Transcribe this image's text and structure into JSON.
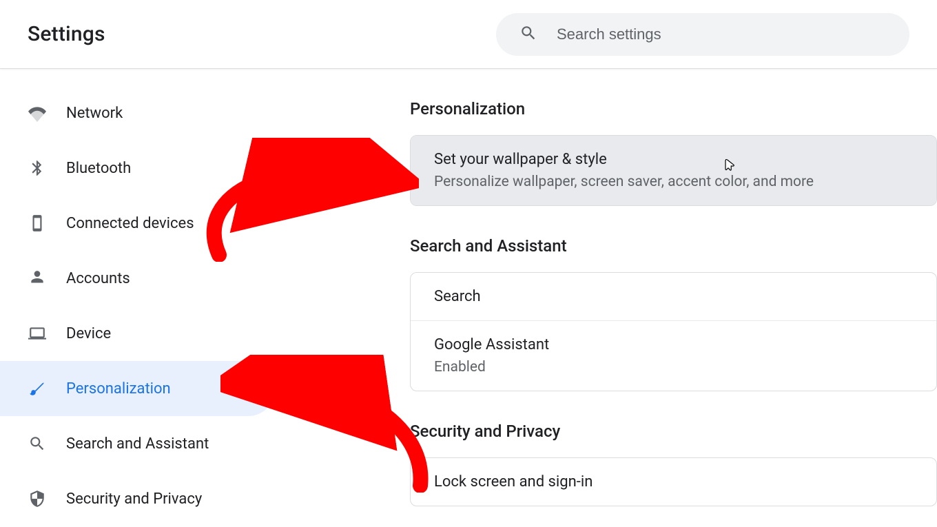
{
  "colors": {
    "accent": "#1a73e8",
    "arrow": "#ff0000"
  },
  "header": {
    "title": "Settings",
    "search_placeholder": "Search settings"
  },
  "sidebar": {
    "items": [
      {
        "id": "network",
        "label": "Network",
        "icon": "wifi-icon"
      },
      {
        "id": "bluetooth",
        "label": "Bluetooth",
        "icon": "bluetooth-icon"
      },
      {
        "id": "devices",
        "label": "Connected devices",
        "icon": "phone-icon"
      },
      {
        "id": "accounts",
        "label": "Accounts",
        "icon": "person-icon"
      },
      {
        "id": "device",
        "label": "Device",
        "icon": "laptop-icon"
      },
      {
        "id": "personalization",
        "label": "Personalization",
        "icon": "brush-icon"
      },
      {
        "id": "search",
        "label": "Search and Assistant",
        "icon": "search-icon"
      },
      {
        "id": "security",
        "label": "Security and Privacy",
        "icon": "shield-icon"
      }
    ],
    "active_id": "personalization"
  },
  "main": {
    "sections": [
      {
        "title": "Personalization",
        "rows": [
          {
            "primary": "Set your wallpaper & style",
            "secondary": "Personalize wallpaper, screen saver, accent color, and more",
            "hover": true
          }
        ]
      },
      {
        "title": "Search and Assistant",
        "rows": [
          {
            "primary": "Search"
          },
          {
            "primary": "Google Assistant",
            "secondary": "Enabled"
          }
        ]
      },
      {
        "title": "Security and Privacy",
        "rows": [
          {
            "primary": "Lock screen and sign-in"
          }
        ]
      }
    ]
  }
}
